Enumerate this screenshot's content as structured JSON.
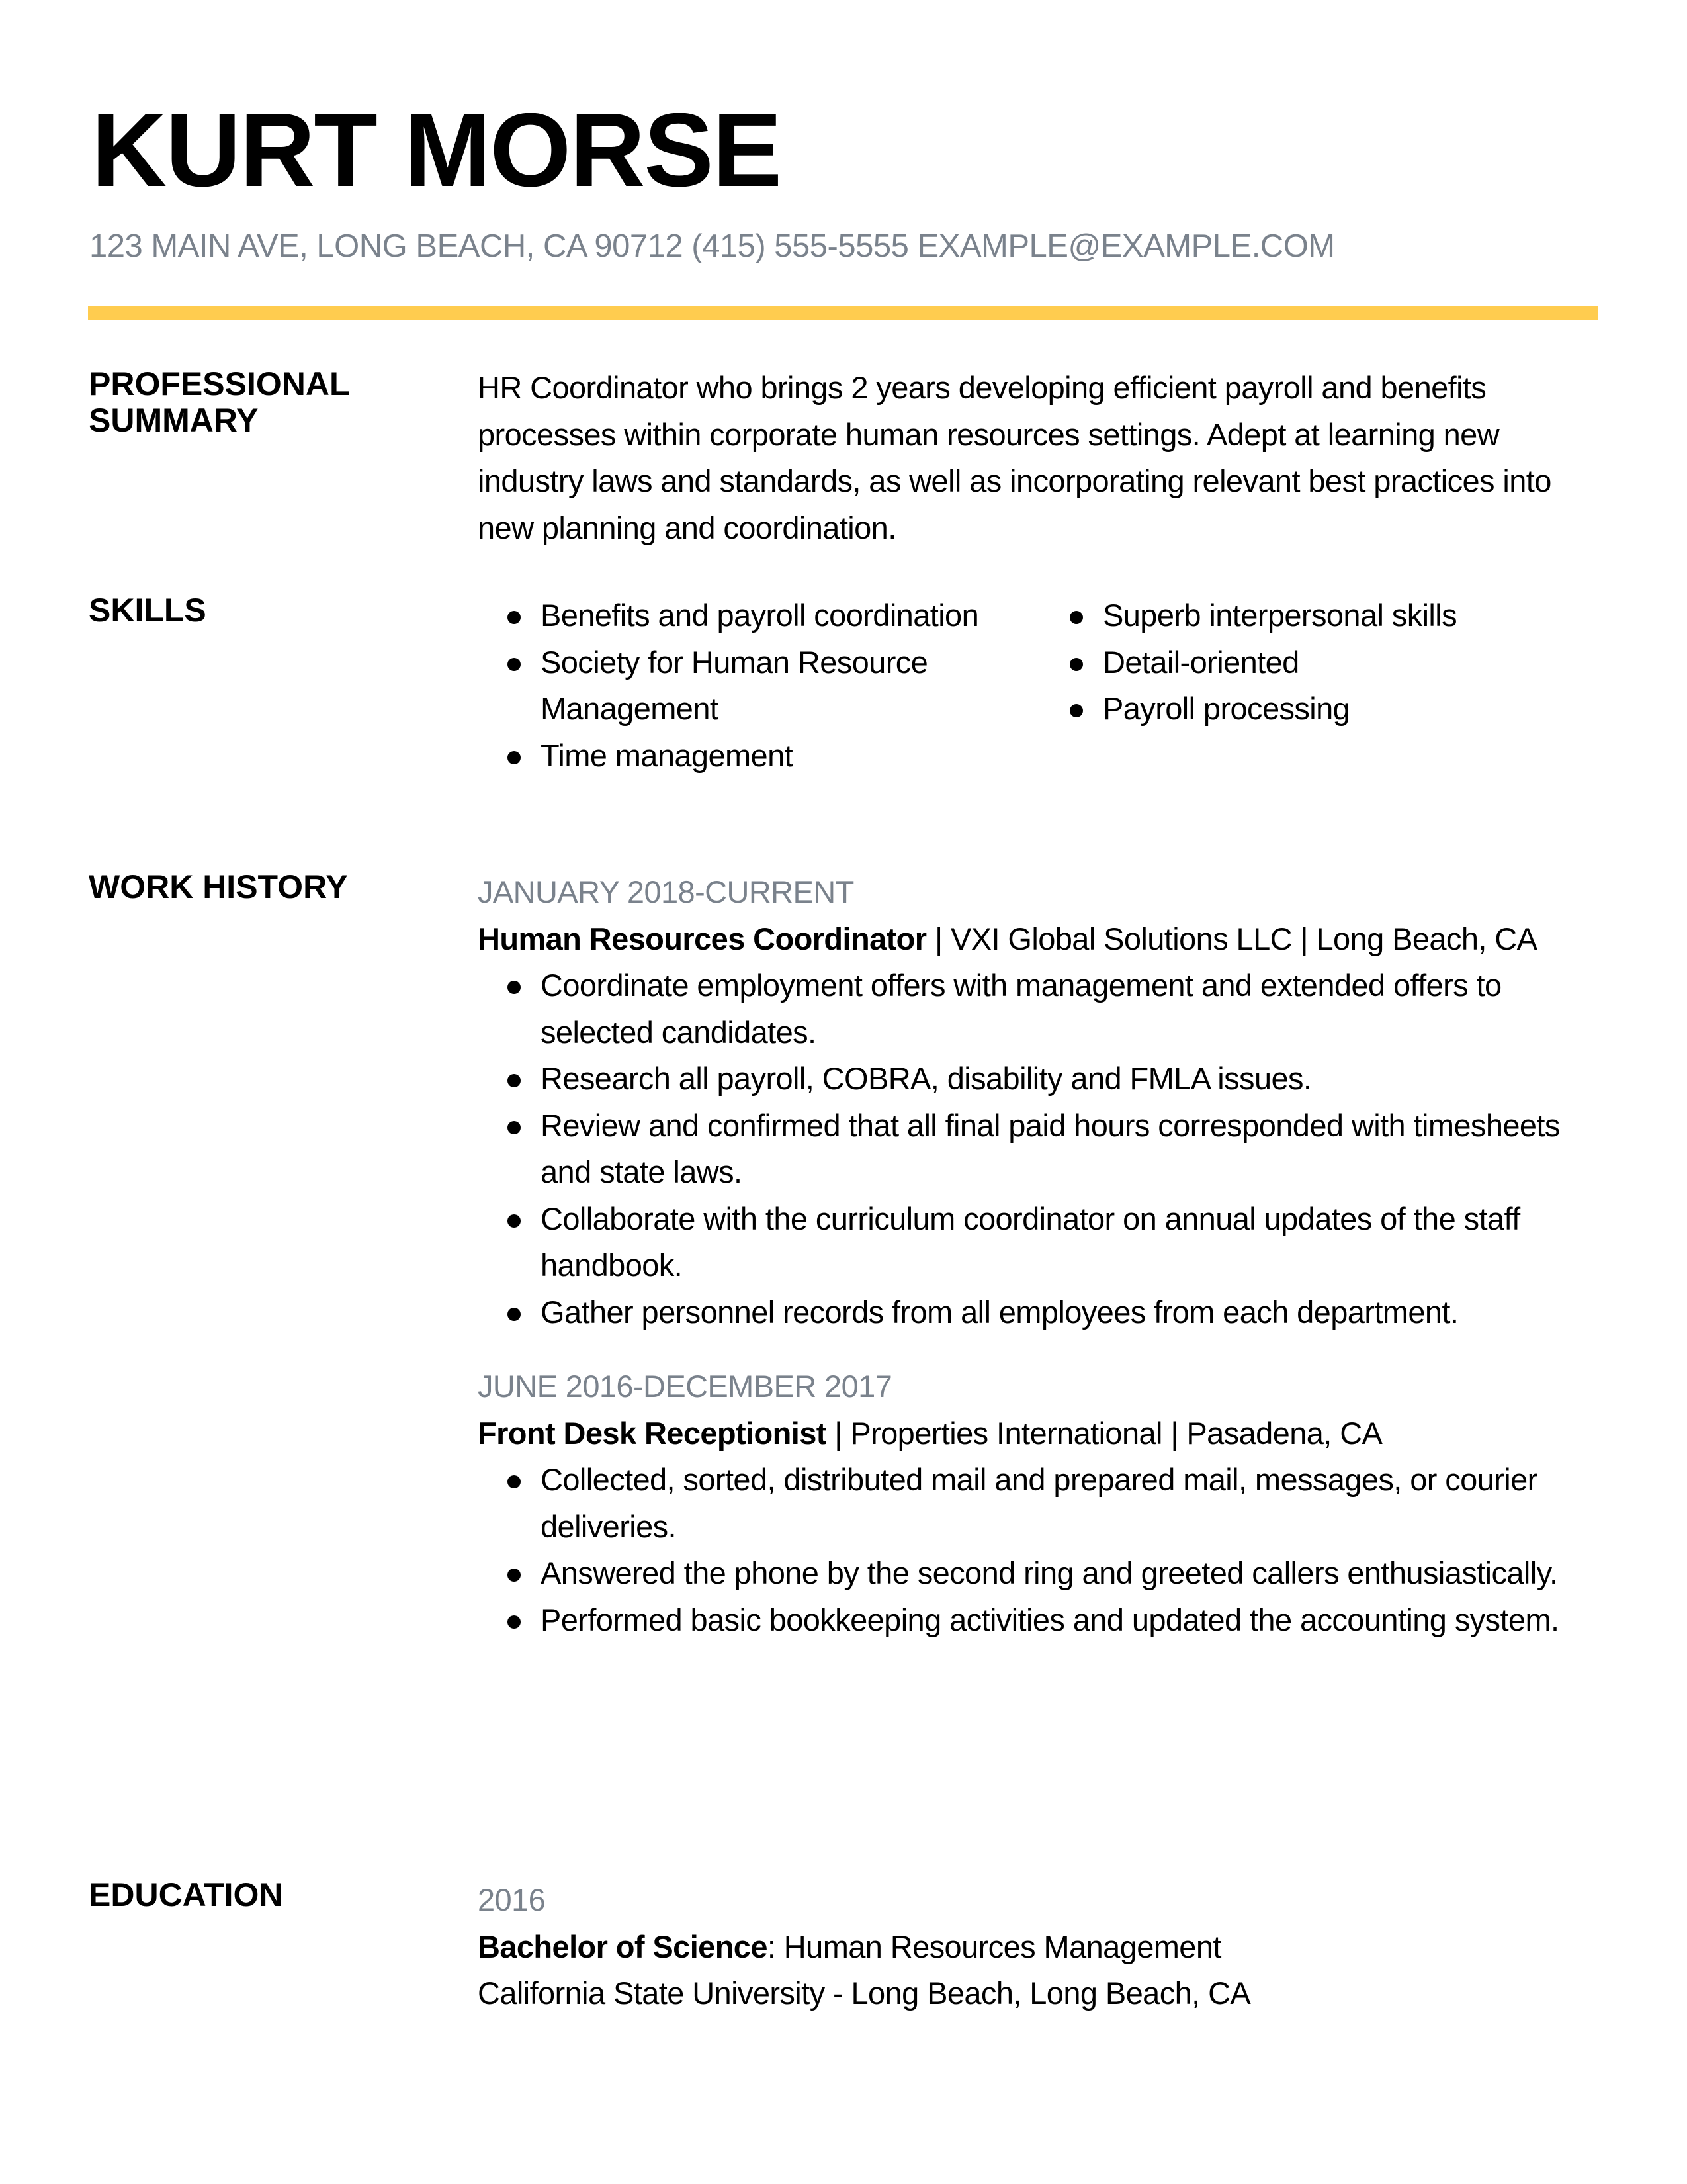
{
  "header": {
    "name": "KURT MORSE",
    "contact": "123 MAIN AVE, LONG BEACH, CA 90712 (415) 555-5555 EXAMPLE@EXAMPLE.COM",
    "accent_color": "#ffcc4f"
  },
  "summary": {
    "title": "PROFESSIONAL SUMMARY",
    "text": "HR Coordinator who brings 2 years developing efficient payroll and benefits processes within corporate human resources settings. Adept at learning new industry laws and standards, as well as incorporating relevant best practices into new planning and coordination."
  },
  "skills": {
    "title": "SKILLS",
    "column1": [
      "Benefits and payroll coordination",
      "Society for Human Resource Management",
      "Time management"
    ],
    "column2": [
      "Superb interpersonal skills",
      "Detail-oriented",
      "Payroll processing"
    ]
  },
  "work_history": {
    "title": "WORK HISTORY",
    "jobs": [
      {
        "dates": "JANUARY 2018-CURRENT",
        "role": "Human Resources Coordinator",
        "details": " | VXI Global Solutions LLC | Long Beach, CA",
        "bullets": [
          "Coordinate employment offers with management and extended offers to selected candidates.",
          "Research all payroll, COBRA, disability and FMLA issues.",
          "Review and confirmed that all final paid hours corresponded with timesheets and state laws.",
          "Collaborate with the curriculum coordinator on annual updates of the staff handbook.",
          "Gather personnel records from all employees from each department."
        ]
      },
      {
        "dates": "JUNE 2016-DECEMBER 2017",
        "role": "Front Desk Receptionist",
        "details": " | Properties International | Pasadena, CA",
        "bullets": [
          "Collected, sorted, distributed mail and prepared mail, messages, or courier deliveries.",
          "Answered the phone by the second ring and greeted callers enthusiastically.",
          "Performed basic bookkeeping activities and updated the accounting system."
        ]
      }
    ]
  },
  "education": {
    "title": "EDUCATION",
    "year": "2016",
    "degree": "Bachelor of Science",
    "field": ": Human Resources Management",
    "school": "California State University - Long Beach, Long Beach, CA"
  }
}
